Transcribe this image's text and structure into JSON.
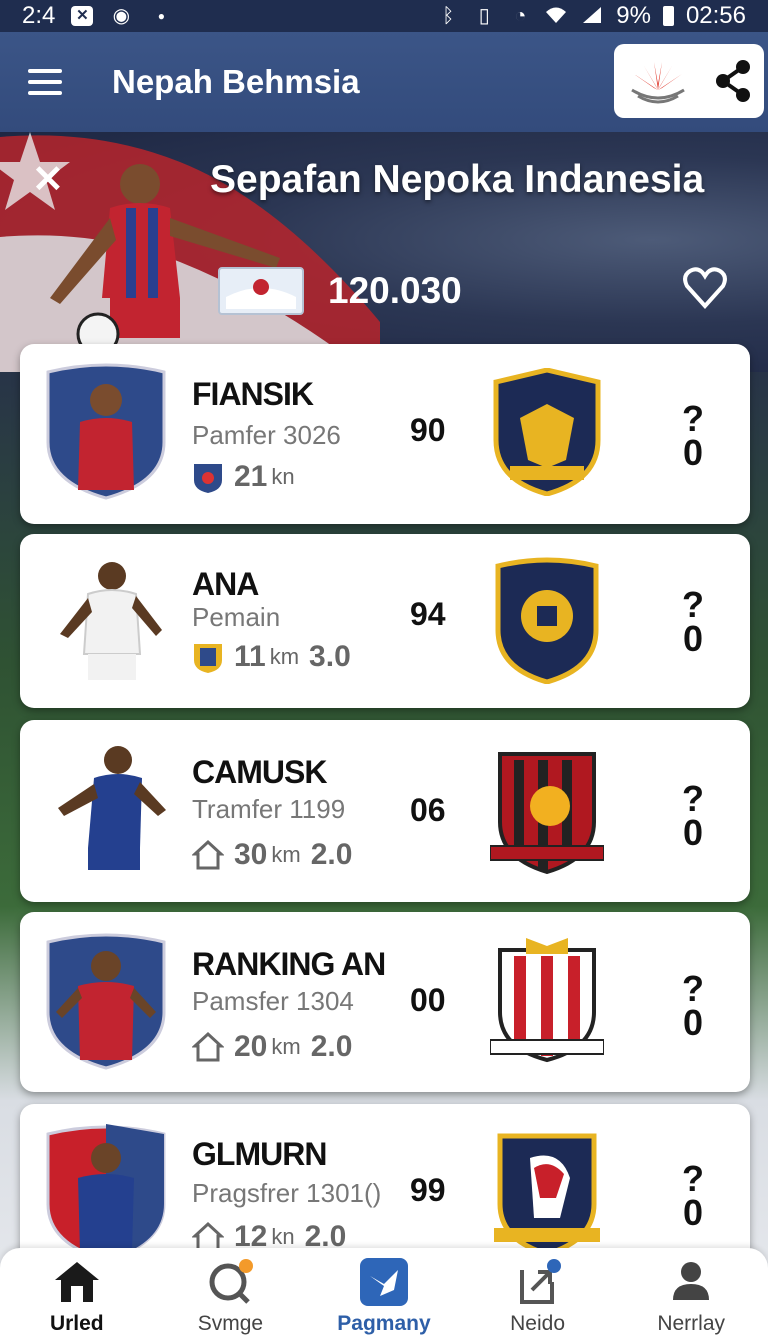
{
  "status_bar": {
    "time_left": "2:4",
    "battery": "9%",
    "time_right": "02:56"
  },
  "app_bar": {
    "title": "Nepah Behmsia"
  },
  "hero": {
    "title": "Sepafan Nepoka Indanesia",
    "value": "120.030"
  },
  "players": [
    {
      "name": "FIANSIK",
      "sub": "Pamfer 3026",
      "meta_value": "21",
      "meta_unit": "kn",
      "meta_extra": "",
      "rating": "90",
      "side_top": "?",
      "side_bottom": "0",
      "crest_color": "#1c2a55",
      "accent": "#e8b422"
    },
    {
      "name": "ANA",
      "sub": "Pemain",
      "meta_value": "11",
      "meta_unit": "km",
      "meta_extra": "3.0",
      "rating": "94",
      "side_top": "?",
      "side_bottom": "0",
      "crest_color": "#1c2a55",
      "accent": "#e8b422"
    },
    {
      "name": "CAMUSK",
      "sub": "Tramfer 1199",
      "meta_value": "30",
      "meta_unit": "km",
      "meta_extra": "2.0",
      "rating": "06",
      "side_top": "?",
      "side_bottom": "0",
      "crest_color": "#b01820",
      "accent": "#f2b020"
    },
    {
      "name": "RANKING AN",
      "sub": "Pamsfer 1304",
      "meta_value": "20",
      "meta_unit": "km",
      "meta_extra": "2.0",
      "rating": "00",
      "side_top": "?",
      "side_bottom": "0",
      "crest_color": "#c8202a",
      "accent": "#ffffff"
    },
    {
      "name": "GLMURN",
      "sub": "Pragsfrer 1301()",
      "meta_value": "12",
      "meta_unit": "kn",
      "meta_extra": "2.0",
      "rating": "99",
      "side_top": "?",
      "side_bottom": "0",
      "crest_color": "#1c2a55",
      "accent": "#e8b422"
    }
  ],
  "bottom_nav": [
    {
      "label": "Urled",
      "icon": "home-icon"
    },
    {
      "label": "Svmge",
      "icon": "search-icon"
    },
    {
      "label": "Pagmany",
      "icon": "bird-icon"
    },
    {
      "label": "Neido",
      "icon": "upload-icon"
    },
    {
      "label": "Nerrlay",
      "icon": "person-icon"
    }
  ]
}
